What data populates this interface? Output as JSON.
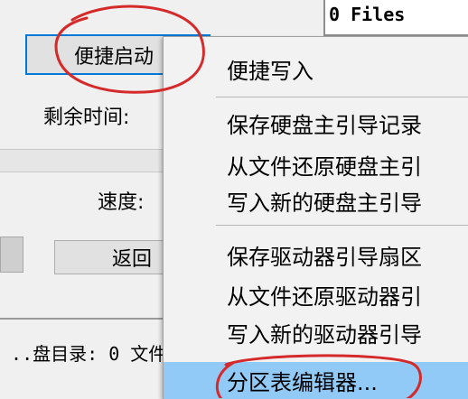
{
  "files_status": "0 Files",
  "buttons": {
    "quick_start": "便捷启动",
    "back": "返回"
  },
  "labels": {
    "remaining_time": "剩余时间:",
    "speed": "速度:"
  },
  "status_bar": {
    "text": " ..盘目录: 0 文件"
  },
  "context_menu": {
    "items": [
      {
        "label": "便捷写入"
      },
      {
        "label": "保存硬盘主引导记录"
      },
      {
        "label": "从文件还原硬盘主引"
      },
      {
        "label": "写入新的硬盘主引导"
      },
      {
        "label": "保存驱动器引导扇区"
      },
      {
        "label": "从文件还原驱动器引"
      },
      {
        "label": "写入新的驱动器引导"
      },
      {
        "label": "分区表编辑器..."
      }
    ],
    "highlighted": "分区表编辑器..."
  },
  "colors": {
    "annotation": "#d42a2a",
    "highlight": "#91c9f7",
    "focus_border": "#0078d7"
  }
}
